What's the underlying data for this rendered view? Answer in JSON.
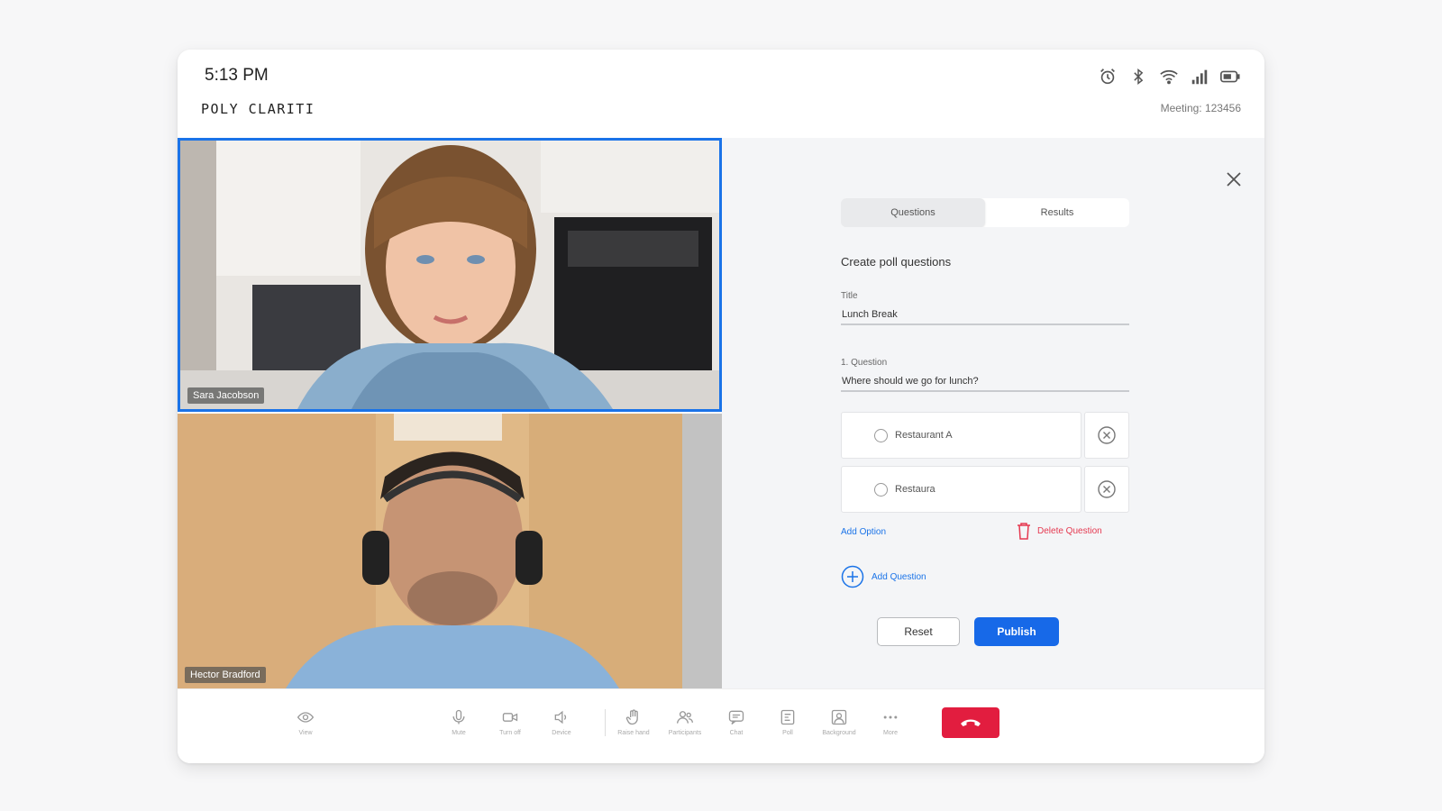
{
  "status": {
    "time": "5:13 PM",
    "brand": "POLY CLARITI",
    "meeting_label": "Meeting: 123456",
    "icons": [
      "alarm-icon",
      "bluetooth-icon",
      "wifi-icon",
      "signal-icon",
      "battery-icon"
    ]
  },
  "videos": [
    {
      "name": "Sara Jacobson"
    },
    {
      "name": "Hector Bradford"
    }
  ],
  "poll": {
    "tabs": [
      {
        "label": "Questions",
        "active": true
      },
      {
        "label": "Results",
        "active": false
      }
    ],
    "heading": "Create poll questions",
    "title_label": "Title",
    "title_value": "Lunch Break",
    "question_label": "1. Question",
    "question_value": "Where should we go for lunch?",
    "options": [
      {
        "value": "Restaurant A"
      },
      {
        "value": "Restaura"
      }
    ],
    "add_option": "Add Option",
    "delete_question": "Delete Question",
    "add_question": "Add Question",
    "reset_label": "Reset",
    "publish_label": "Publish"
  },
  "toolbar": {
    "view": "View",
    "mute": "Mute",
    "camera": "Turn off",
    "device": "Device",
    "hand": "Raise hand",
    "participants": "Participants",
    "chat": "Chat",
    "poll": "Poll",
    "background": "Background",
    "more": "More"
  },
  "colors": {
    "accent": "#1a73e8",
    "publish": "#1769e8",
    "end_call": "#e21d3f",
    "danger": "#e53950",
    "panel_bg": "#f4f5f7"
  }
}
